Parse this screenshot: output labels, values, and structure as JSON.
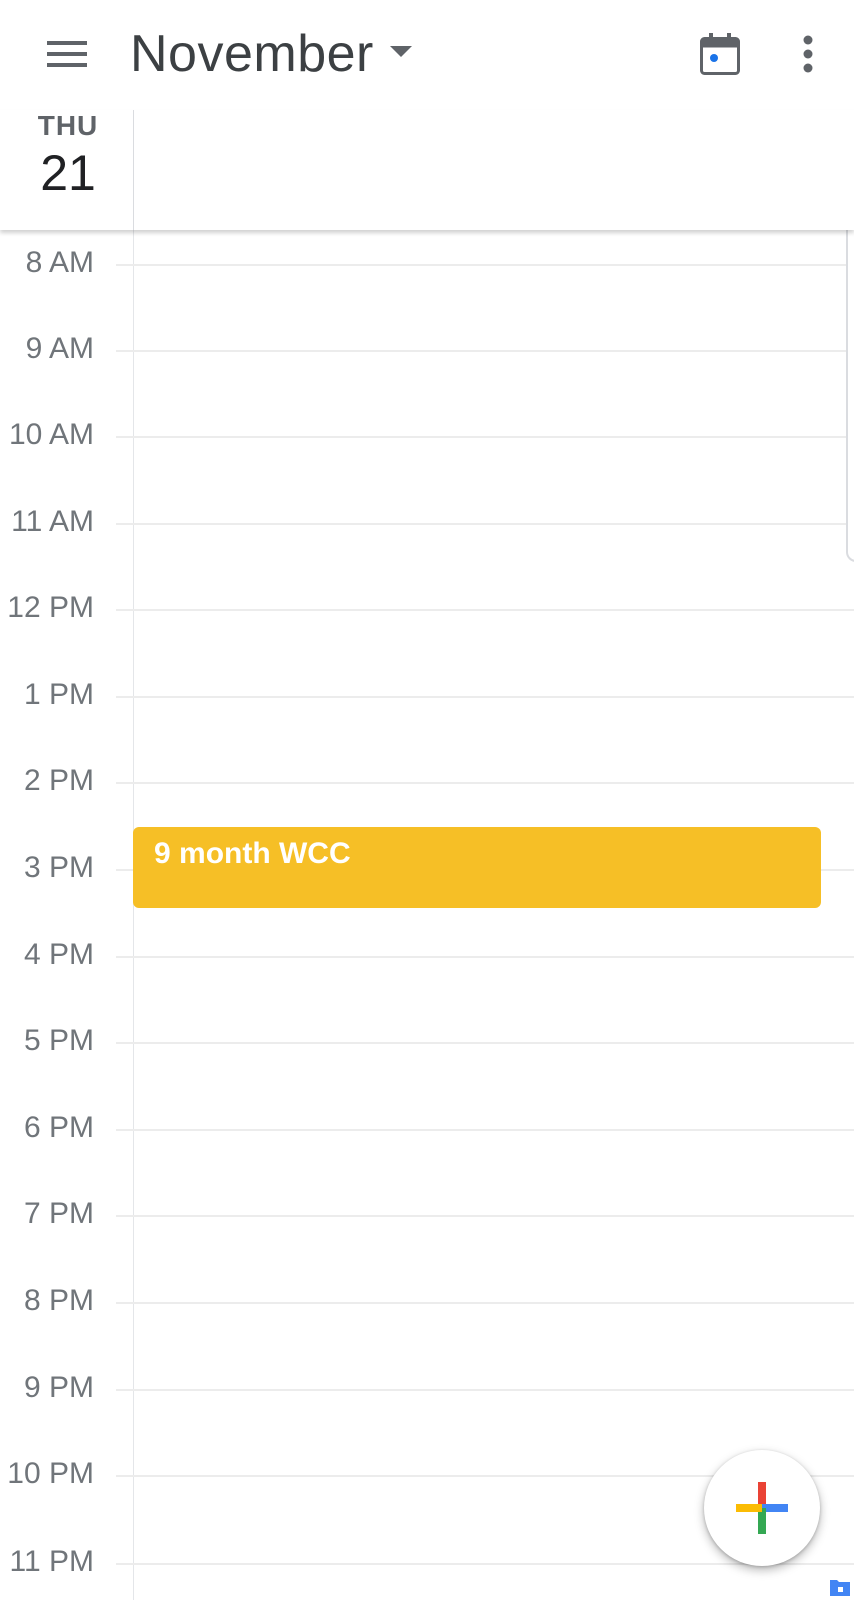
{
  "header": {
    "month_title": "November"
  },
  "day": {
    "day_of_week": "THU",
    "day_of_month": "21"
  },
  "hours": [
    "8 AM",
    "9 AM",
    "10 AM",
    "11 AM",
    "12 PM",
    "1 PM",
    "2 PM",
    "3 PM",
    "4 PM",
    "5 PM",
    "6 PM",
    "7 PM",
    "8 PM",
    "9 PM",
    "10 PM",
    "11 PM"
  ],
  "events": [
    {
      "title": "9 month WCC",
      "color": "#f6bf26"
    }
  ],
  "icons": {
    "menu": "hamburger-menu-icon",
    "caret": "caret-down-icon",
    "today": "calendar-today-icon",
    "more": "more-vert-icon",
    "fab": "plus-icon"
  },
  "colors": {
    "accent_blue": "#1a73e8",
    "google_red": "#ea4335",
    "google_yellow": "#fbbc04",
    "google_green": "#34a853",
    "google_blue": "#4285f4",
    "text_primary": "#3c4043",
    "text_secondary": "#70757a"
  }
}
